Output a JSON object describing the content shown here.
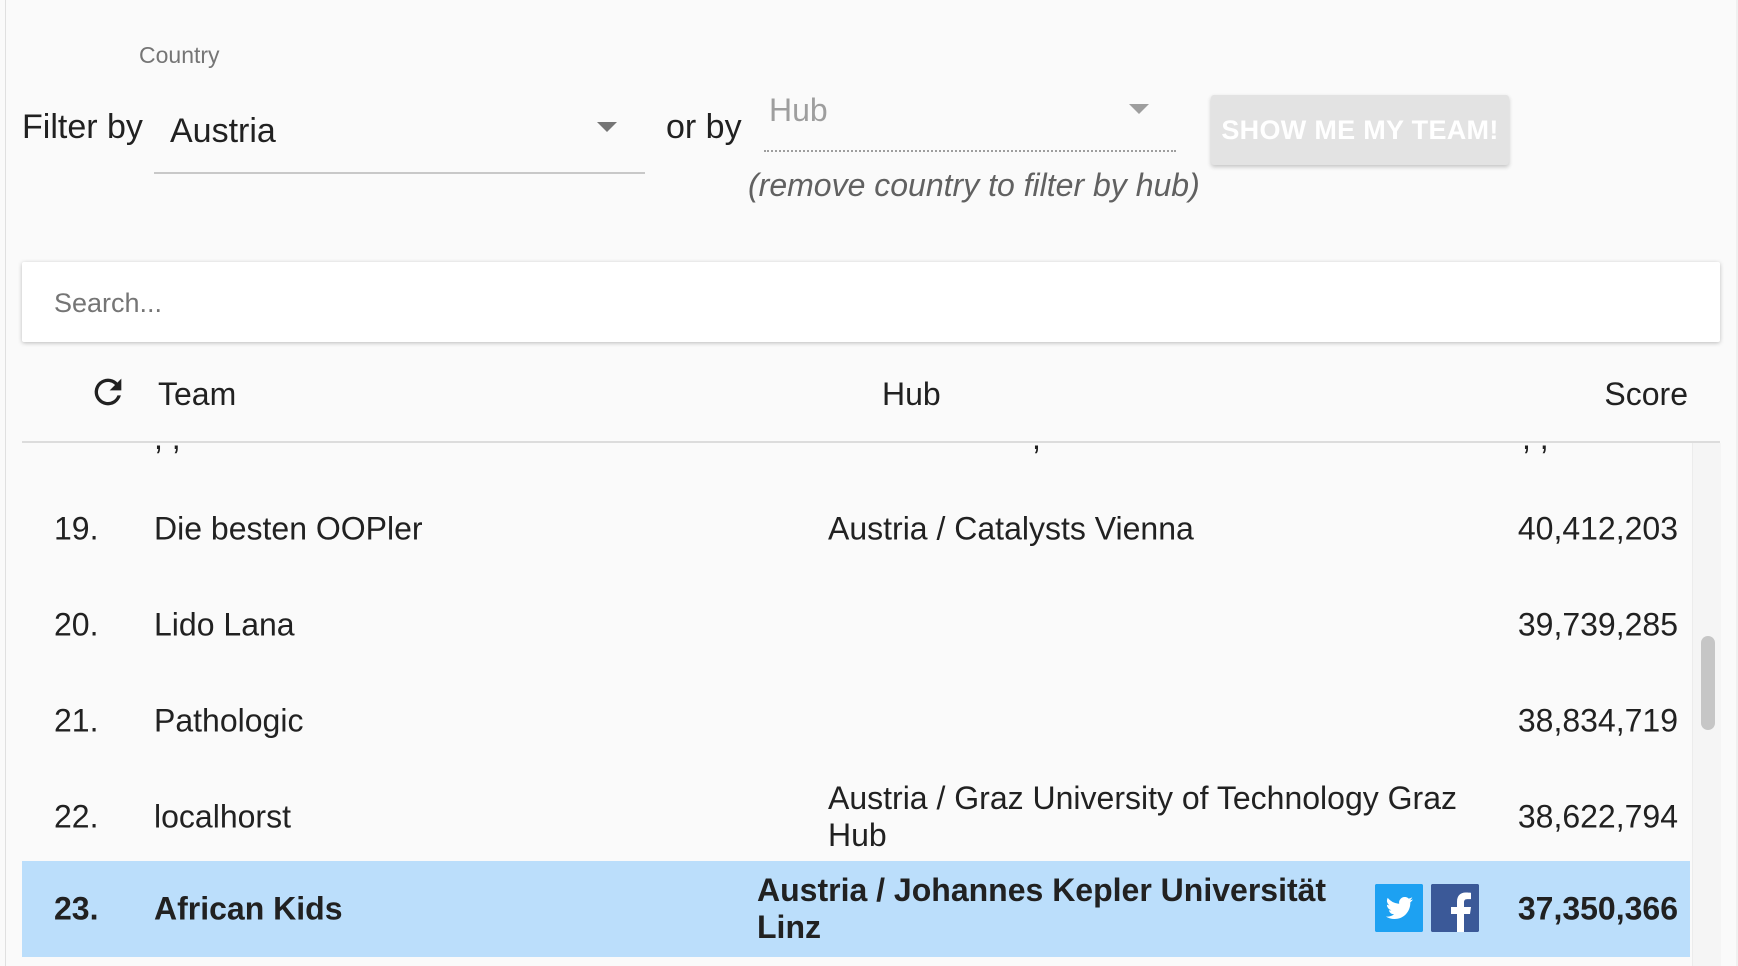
{
  "filters": {
    "country_caption": "Country",
    "filter_by_label": "Filter by",
    "country_value": "Austria",
    "or_by_label": "or by",
    "hub_placeholder": "Hub",
    "hub_hint": "(remove country to filter by hub)",
    "show_team_label": "SHOW ME MY TEAM!"
  },
  "search": {
    "placeholder": "Search...",
    "value": ""
  },
  "table": {
    "headers": {
      "team": "Team",
      "hub": "Hub",
      "score": "Score"
    },
    "rows": [
      {
        "rank": "19.",
        "team": "Die besten OOPler",
        "hub": "Austria / Catalysts Vienna",
        "score": "40,412,203"
      },
      {
        "rank": "20.",
        "team": "Lido Lana",
        "hub": "",
        "score": "39,739,285"
      },
      {
        "rank": "21.",
        "team": "Pathologic",
        "hub": "",
        "score": "38,834,719"
      },
      {
        "rank": "22.",
        "team": "localhorst",
        "hub": "Austria / Graz University of Technology Graz Hub",
        "score": "38,622,794"
      },
      {
        "rank": "23.",
        "team": "African Kids",
        "hub": "Austria / Johannes Kepler Universität Linz",
        "score": "37,350,366",
        "highlighted": true
      }
    ]
  },
  "icons": {
    "refresh": "refresh-icon",
    "country_caret": "chevron-down-icon",
    "hub_caret": "chevron-down-icon",
    "twitter": "twitter-icon",
    "facebook": "facebook-icon"
  },
  "colors": {
    "highlight_row": "#bbdefb",
    "twitter": "#1da1f2",
    "facebook": "#3b5998",
    "button_disabled": "#e3e3e3",
    "background": "#fafafa"
  }
}
